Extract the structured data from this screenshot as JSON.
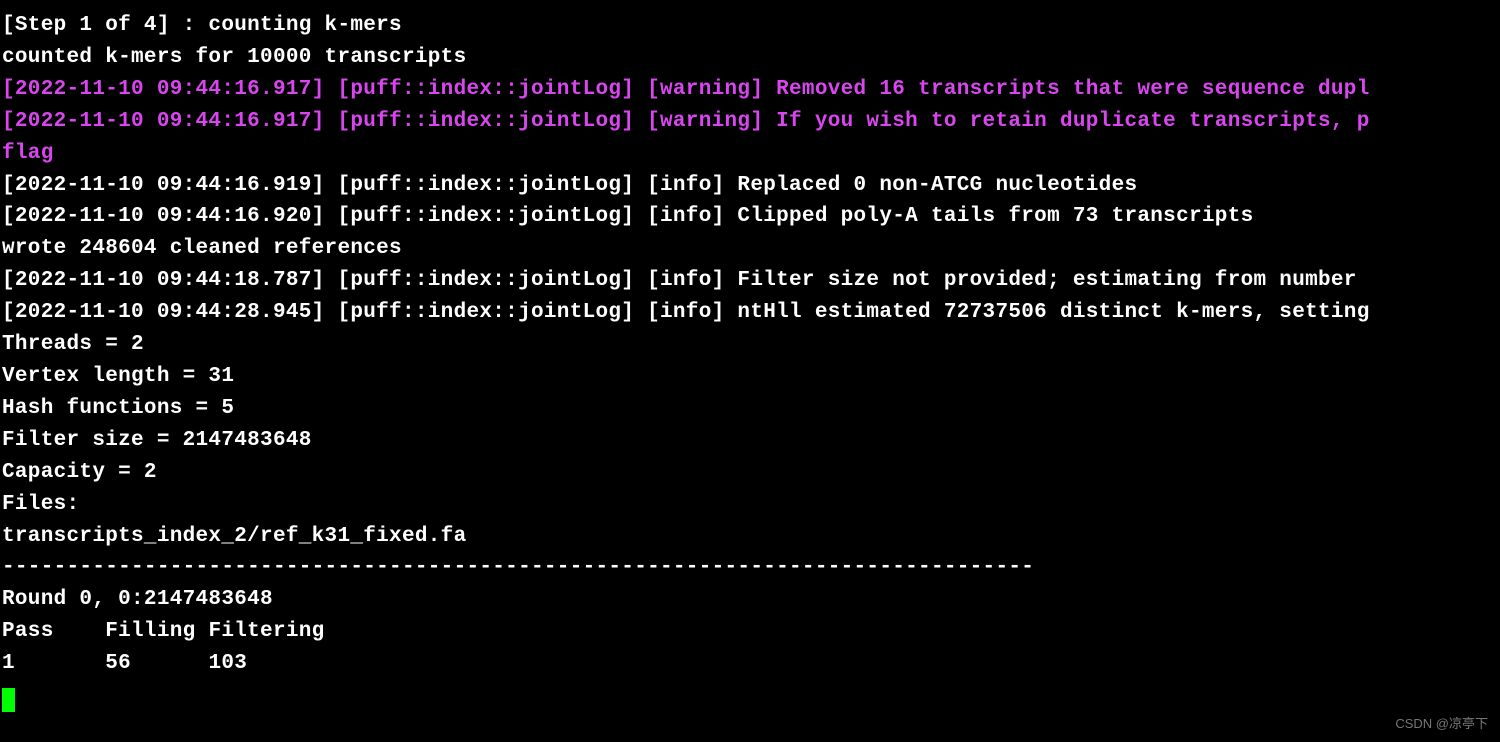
{
  "lines": [
    {
      "cls": "info",
      "text": "[Step 1 of 4] : counting k-mers"
    },
    {
      "cls": "info",
      "text": "counted k-mers for 10000 transcripts"
    },
    {
      "cls": "warn",
      "text": "[2022-11-10 09:44:16.917] [puff::index::jointLog] [warning] Removed 16 transcripts that were sequence dupl"
    },
    {
      "cls": "warn",
      "text": "[2022-11-10 09:44:16.917] [puff::index::jointLog] [warning] If you wish to retain duplicate transcripts, p"
    },
    {
      "cls": "warn",
      "text": "flag"
    },
    {
      "cls": "info",
      "text": "[2022-11-10 09:44:16.919] [puff::index::jointLog] [info] Replaced 0 non-ATCG nucleotides"
    },
    {
      "cls": "info",
      "text": "[2022-11-10 09:44:16.920] [puff::index::jointLog] [info] Clipped poly-A tails from 73 transcripts"
    },
    {
      "cls": "info",
      "text": "wrote 248604 cleaned references"
    },
    {
      "cls": "info",
      "text": "[2022-11-10 09:44:18.787] [puff::index::jointLog] [info] Filter size not provided; estimating from number "
    },
    {
      "cls": "info",
      "text": "[2022-11-10 09:44:28.945] [puff::index::jointLog] [info] ntHll estimated 72737506 distinct k-mers, setting"
    },
    {
      "cls": "info",
      "text": "Threads = 2"
    },
    {
      "cls": "info",
      "text": "Vertex length = 31"
    },
    {
      "cls": "info",
      "text": "Hash functions = 5"
    },
    {
      "cls": "info",
      "text": "Filter size = 2147483648"
    },
    {
      "cls": "info",
      "text": "Capacity = 2"
    },
    {
      "cls": "info",
      "text": "Files: "
    },
    {
      "cls": "info",
      "text": "transcripts_index_2/ref_k31_fixed.fa"
    },
    {
      "cls": "info",
      "text": "--------------------------------------------------------------------------------"
    },
    {
      "cls": "info",
      "text": "Round 0, 0:2147483648"
    },
    {
      "cls": "info",
      "text": "Pass\tFilling\tFiltering"
    },
    {
      "cls": "info",
      "text": "1\t56\t103\t"
    }
  ],
  "watermark": "CSDN @凉亭下"
}
